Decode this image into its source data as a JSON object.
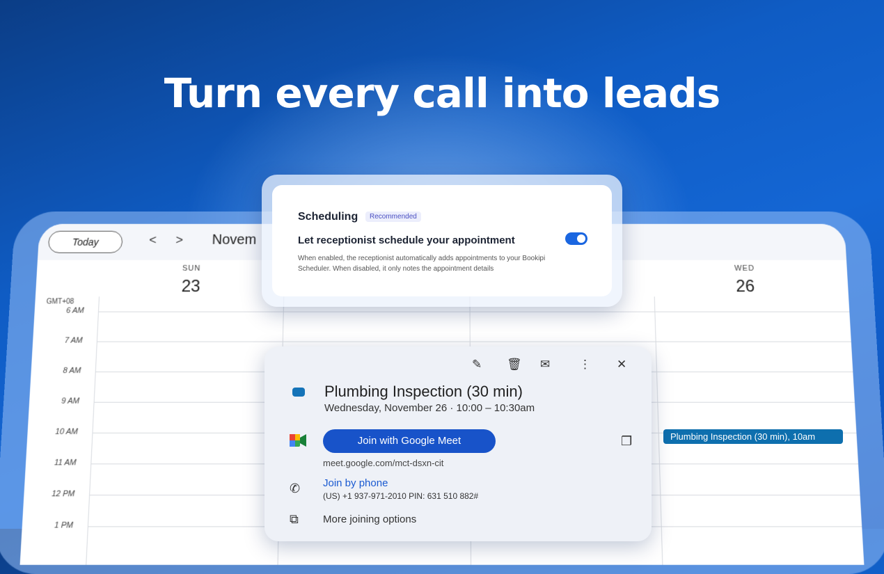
{
  "headline": "Turn every call into leads",
  "calendar": {
    "today_label": "Today",
    "prev_arrow": "<",
    "next_arrow": ">",
    "month_label": "Novem",
    "timezone": "GMT+08",
    "days": [
      {
        "name": "SUN",
        "num": "23"
      },
      {
        "name": "WED",
        "num": "26"
      }
    ],
    "times": [
      "6 AM",
      "7 AM",
      "8 AM",
      "9 AM",
      "10 AM",
      "11 AM",
      "12 PM",
      "1 PM"
    ],
    "event_chip": "Plumbing Inspection (30 min), 10am"
  },
  "scheduling": {
    "title": "Scheduling",
    "badge": "Recommended",
    "option_label": "Let receptionist schedule your appointment",
    "description": "When enabled, the receptionist automatically adds appointments to your Bookipi Scheduler. When disabled, it only notes the appointment details",
    "toggle_on": true,
    "accent_color": "#1a66e0"
  },
  "event_popup": {
    "title": "Plumbing Inspection (30 min)",
    "datetime": "Wednesday, November 26  ·  10:00 – 10:30am",
    "meet_button": "Join with Google Meet",
    "meet_link": "meet.google.com/mct-dsxn-cit",
    "phone_link": "Join by phone",
    "phone_detail": "(US) +1 937-971-2010 PIN: 631 510 882#",
    "more_options": "More joining options",
    "event_color": "#1473b8",
    "button_color": "#1853c9"
  },
  "icons": {
    "edit": "✎",
    "delete": "🗑",
    "email": "✉",
    "more": "⋮",
    "close": "✕",
    "copy": "❐",
    "phone": "✆",
    "external": "⧉"
  }
}
